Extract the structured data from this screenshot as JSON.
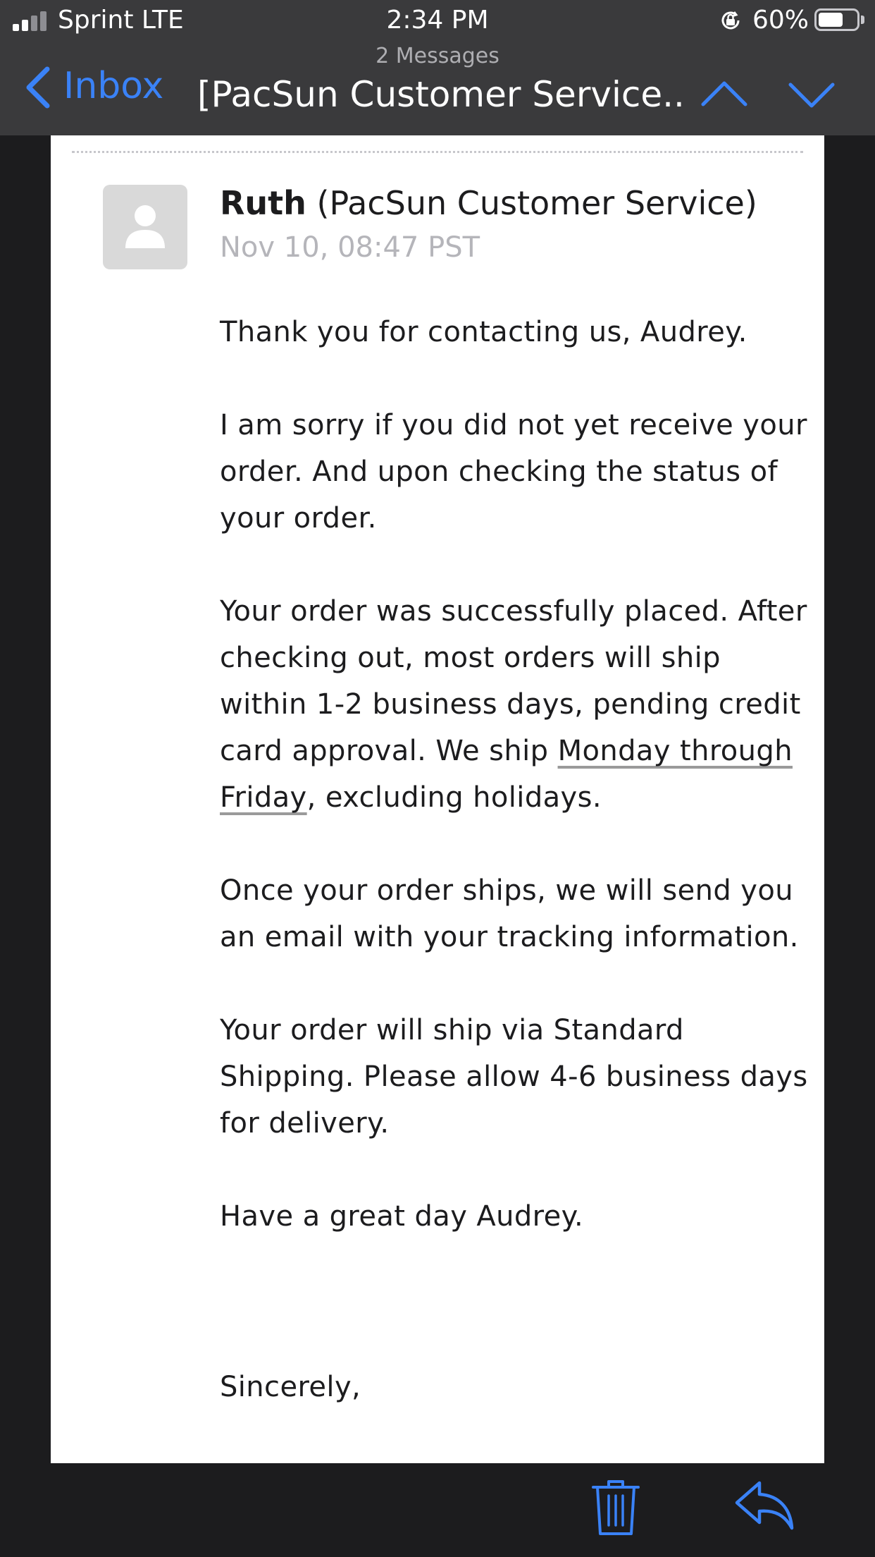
{
  "status_bar": {
    "carrier": "Sprint LTE",
    "time": "2:34 PM",
    "battery_percent": "60%",
    "battery_level": 0.6,
    "signal_bars": 2,
    "signal_bars_total": 4
  },
  "nav": {
    "back_label": "Inbox",
    "messages_count": "2 Messages",
    "title": "[PacSun Customer Service...",
    "accent_color": "#3a82f7"
  },
  "message": {
    "sender_name": "Ruth",
    "sender_org": "(PacSun Customer Service)",
    "date": "Nov 10, 08:47 PST",
    "greeting": "Thank you for contacting us, Audrey.",
    "para2": "I am sorry if you did not yet receive your order. And upon checking the status of your order.",
    "para3_start": "Your order was successfully placed. After checking out, most orders will ship within 1-2 business days, pending credit card approval. We ship ",
    "para3_link": "Monday through Friday",
    "para3_end": ", excluding holidays.",
    "para4": "Once your order ships, we will send you an email with your tracking information.",
    "para5": "Your order will ship via Standard Shipping. Please allow 4-6 business days for delivery.",
    "closing": "Have a great day Audrey.",
    "signoff": "Sincerely,"
  },
  "toolbar": {
    "icons": [
      "trash-icon",
      "reply-icon"
    ]
  }
}
